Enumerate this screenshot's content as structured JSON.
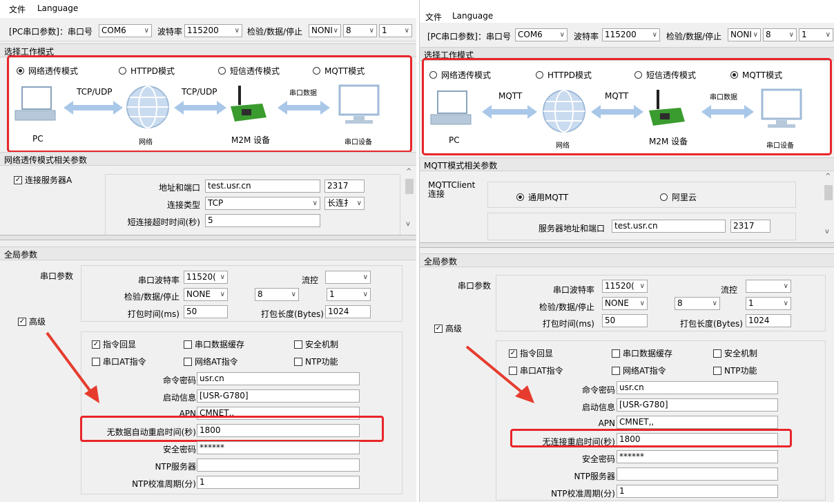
{
  "colors": {
    "highlight_red": "#e8252a",
    "arrow_blue": "#a9c7e8",
    "arrow_red": "#e63c2e",
    "device_green": "#3a9b2e"
  },
  "icons": [
    "pc-icon",
    "globe-icon",
    "m2m-device-icon",
    "monitor-icon",
    "double-arrow-icon",
    "red-arrow-icon"
  ],
  "left": {
    "menu": {
      "file": "文件",
      "language": "Language"
    },
    "toolbar": {
      "serial_label": "[PC串口参数]：串口号",
      "serial_value": "COM6",
      "baud_label": "波特率",
      "baud_value": "115200",
      "parity_label": "检验/数据/停止",
      "parity_value": "NONI",
      "data_value": "8",
      "stop_value": "1"
    },
    "mode_section": {
      "title": "选择工作模式",
      "modes": [
        "网络透传模式",
        "HTTPD模式",
        "短信透传模式",
        "MQTT模式"
      ],
      "selected_index": 0,
      "diagram": {
        "link1": "TCP/UDP",
        "link2": "TCP/UDP",
        "link3": "串口数据",
        "pc": "PC",
        "network": "网络",
        "device": "M2M 设备",
        "serial_device": "串口设备"
      }
    },
    "param_section": {
      "title": "网络透传模式相关参数",
      "connect_checkbox": "连接服务器A",
      "addr_label": "地址和端口",
      "addr_value": "test.usr.cn",
      "port_value": "2317",
      "conn_type_label": "连接类型",
      "conn_type_value": "TCP",
      "conn_mode_value": "长连扌",
      "timeout_label": "短连接超时时间(秒)",
      "timeout_value": "5"
    },
    "global": {
      "title": "全局参数",
      "serial_params": "串口参数",
      "baud_label": "串口波特率",
      "baud_value": "11520(",
      "flow_label": "流控",
      "flow_value": "",
      "parity_label": "检验/数据/停止",
      "parity_value": "NONE",
      "data_value": "8",
      "stop_value": "1",
      "pack_time_label": "打包时间(ms)",
      "pack_time_value": "50",
      "pack_len_label": "打包长度(Bytes)",
      "pack_len_value": "1024",
      "advanced": "高级",
      "checks": [
        "指令回显",
        "串口数据缓存",
        "安全机制",
        "串口AT指令",
        "网络AT指令",
        "NTP功能"
      ],
      "checks_state": [
        true,
        false,
        false,
        false,
        false,
        false
      ],
      "cmd_pwd_label": "命令密码",
      "cmd_pwd_value": "usr.cn",
      "boot_info_label": "启动信息",
      "boot_info_value": "[USR-G780]",
      "apn_label": "APN",
      "apn_value": "CMNET,,",
      "restart_label": "无数据自动重启时间(秒)",
      "restart_value": "1800",
      "sec_pwd_label": "安全密码",
      "sec_pwd_value": "******",
      "ntp_server_label": "NTP服务器",
      "ntp_server_value": "",
      "ntp_period_label": "NTP校准周期(分)",
      "ntp_period_value": "1"
    }
  },
  "right": {
    "menu": {
      "file": "文件",
      "language": "Language"
    },
    "toolbar": {
      "serial_label": "[PC串口参数]：串口号",
      "serial_value": "COM6",
      "baud_label": "波特率",
      "baud_value": "115200",
      "parity_label": "检验/数据/停止",
      "parity_value": "NONI",
      "data_value": "8",
      "stop_value": "1"
    },
    "mode_section": {
      "title": "选择工作模式",
      "modes": [
        "网络透传模式",
        "HTTPD模式",
        "短信透传模式",
        "MQTT模式"
      ],
      "selected_index": 3,
      "diagram": {
        "link1": "MQTT",
        "link2": "MQTT",
        "link3": "串口数据",
        "pc": "PC",
        "network": "网络",
        "device": "M2M 设备",
        "serial_device": "串口设备"
      }
    },
    "param_section": {
      "title": "MQTT模式相关参数",
      "client_label": "MQTTClient\n连接",
      "option_general": "通用MQTT",
      "option_aliyun": "阿里云",
      "addr_label": "服务器地址和端口",
      "addr_value": "test.usr.cn",
      "port_value": "2317"
    },
    "global": {
      "title": "全局参数",
      "serial_params": "串口参数",
      "baud_label": "串口波特率",
      "baud_value": "11520(",
      "flow_label": "流控",
      "flow_value": "",
      "parity_label": "检验/数据/停止",
      "parity_value": "NONE",
      "data_value": "8",
      "stop_value": "1",
      "pack_time_label": "打包时间(ms)",
      "pack_time_value": "50",
      "pack_len_label": "打包长度(Bytes)",
      "pack_len_value": "1024",
      "advanced": "高级",
      "checks": [
        "指令回显",
        "串口数据缓存",
        "安全机制",
        "串口AT指令",
        "网络AT指令",
        "NTP功能"
      ],
      "checks_state": [
        true,
        false,
        false,
        false,
        false,
        false
      ],
      "cmd_pwd_label": "命令密码",
      "cmd_pwd_value": "usr.cn",
      "boot_info_label": "启动信息",
      "boot_info_value": "[USR-G780]",
      "apn_label": "APN",
      "apn_value": "CMNET,,",
      "restart_label": "无连接重启时间(秒)",
      "restart_value": "1800",
      "sec_pwd_label": "安全密码",
      "sec_pwd_value": "******",
      "ntp_server_label": "NTP服务器",
      "ntp_server_value": "",
      "ntp_period_label": "NTP校准周期(分)",
      "ntp_period_value": "1"
    }
  }
}
